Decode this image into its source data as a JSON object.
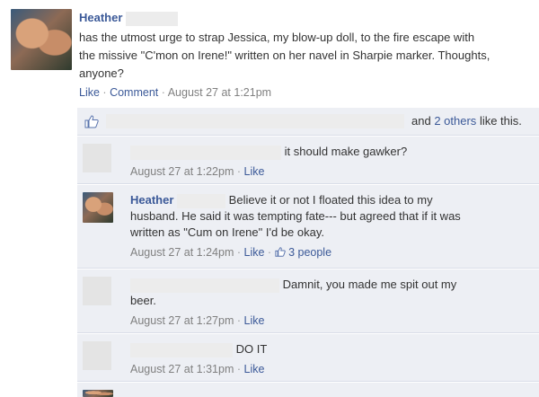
{
  "post": {
    "author": "Heather",
    "text_line1": "has the utmost urge to strap Jessica, my blow-up doll, to the fire escape with",
    "text_line2": "the missive \"C'mon on Irene!\" written on her navel in Sharpie marker. Thoughts,",
    "text_line3": "anyone?",
    "like_label": "Like",
    "sep": "·",
    "comment_label": "Comment",
    "timestamp": "August 27 at 1:21pm"
  },
  "likes": {
    "and_text": "and",
    "others_link": "2 others",
    "suffix": "like this."
  },
  "comments": [
    {
      "text": "it should make gawker?",
      "timestamp": "August 27 at 1:22pm",
      "like_label": "Like"
    },
    {
      "author": "Heather",
      "line1": "Believe it or not I floated this idea to my",
      "line2": "husband. He said it was tempting fate--- but agreed that if it was",
      "line3": "written as \"Cum on Irene\" I'd be okay.",
      "timestamp": "August 27 at 1:24pm",
      "like_label": "Like",
      "people_label": "3 people"
    },
    {
      "line1": "Damnit, you made me spit out my",
      "line2": "beer.",
      "timestamp": "August 27 at 1:27pm",
      "like_label": "Like"
    },
    {
      "text": "DO IT",
      "timestamp": "August 27 at 1:31pm",
      "like_label": "Like"
    }
  ],
  "colors": {
    "link": "#3b5998",
    "comment_bg": "#edeff4",
    "meta": "#808080"
  }
}
